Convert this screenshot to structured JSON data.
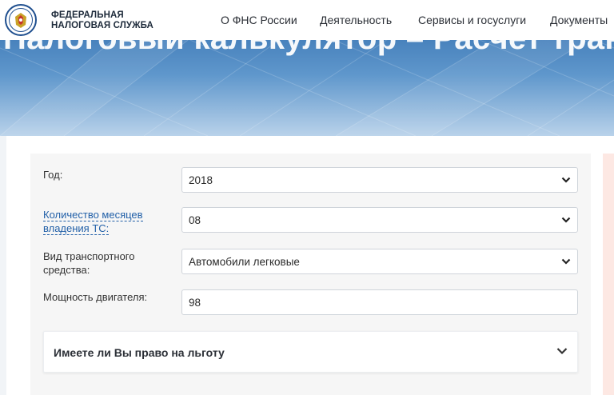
{
  "header": {
    "org_line1": "ФЕДЕРАЛЬНАЯ",
    "org_line2": "НАЛОГОВАЯ СЛУЖБА",
    "nav": [
      "О ФНС России",
      "Деятельность",
      "Сервисы и госуслуги",
      "Документы"
    ]
  },
  "hero": {
    "title": "Налоговый калькулятор – Расчет транспорт"
  },
  "form": {
    "year_label": "Год:",
    "year_value": "2018",
    "months_label": "Количество месяцев владения ТС:",
    "months_value": "08",
    "vehicle_type_label": "Вид транспортного средства:",
    "vehicle_type_value": "Автомобили легковые",
    "power_label": "Мощность двигателя:",
    "power_value": "98"
  },
  "benefit": {
    "title": "Имеете ли Вы право на льготу"
  },
  "icons": {
    "logo": "emblem-icon",
    "dropdown": "chevron-down-icon"
  },
  "colors": {
    "link": "#2260a8",
    "hero_top": "#2e6aab"
  }
}
